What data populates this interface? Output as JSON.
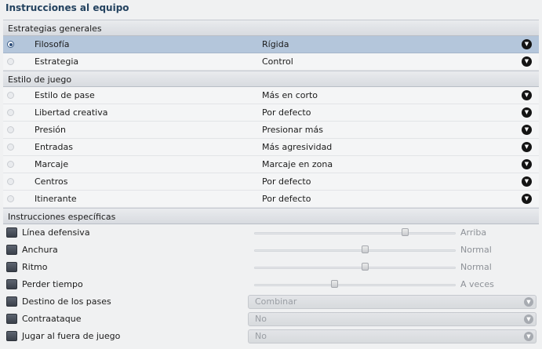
{
  "title": "Instrucciones al equipo",
  "sections": [
    {
      "header": "Estrategias generales",
      "rows": [
        {
          "label": "Filosofía",
          "value": "Rígida",
          "selected": true
        },
        {
          "label": "Estrategia",
          "value": "Control",
          "selected": false
        }
      ]
    },
    {
      "header": "Estilo de juego",
      "rows": [
        {
          "label": "Estilo de pase",
          "value": "Más en corto"
        },
        {
          "label": "Libertad creativa",
          "value": "Por defecto"
        },
        {
          "label": "Presión",
          "value": "Presionar más"
        },
        {
          "label": "Entradas",
          "value": "Más agresividad"
        },
        {
          "label": "Marcaje",
          "value": "Marcaje en zona"
        },
        {
          "label": "Centros",
          "value": "Por defecto"
        },
        {
          "label": "Itinerante",
          "value": "Por defecto"
        }
      ]
    }
  ],
  "specific": {
    "header": "Instrucciones específicas",
    "sliders": [
      {
        "label": "Línea defensiva",
        "value": "Arriba",
        "level": 0.75
      },
      {
        "label": "Anchura",
        "value": "Normal",
        "level": 0.55
      },
      {
        "label": "Ritmo",
        "value": "Normal",
        "level": 0.55
      },
      {
        "label": "Perder tiempo",
        "value": "A veces",
        "level": 0.4
      }
    ],
    "dropdowns": [
      {
        "label": "Destino de los pases",
        "value": "Combinar"
      },
      {
        "label": "Contraataque",
        "value": "No"
      },
      {
        "label": "Jugar al fuera de juego",
        "value": "No"
      }
    ]
  },
  "icons": {
    "dropdown": "chevron-down-icon",
    "radio": "radio-icon",
    "checkbox": "checkbox-icon"
  },
  "colors": {
    "title": "#23425f",
    "selected_row": "#b4c6db"
  }
}
